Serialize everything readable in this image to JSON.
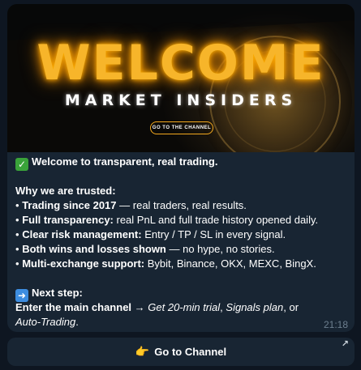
{
  "banner": {
    "title": "WELCOME",
    "subtitle": "MARKET INSIDERS",
    "button_label": "GO TO THE CHANNEL"
  },
  "message": {
    "headline": "Welcome to transparent, real trading.",
    "why_heading": "Why we are trusted:",
    "bullets": [
      {
        "bold": "Trading since 2017",
        "rest": " — real traders, real results."
      },
      {
        "bold": "Full transparency:",
        "rest": " real PnL and full trade history opened daily."
      },
      {
        "bold": "Clear risk management:",
        "rest": " Entry / TP / SL in every signal."
      },
      {
        "bold": "Both wins and losses shown",
        "rest": " — no hype, no stories."
      },
      {
        "bold": "Multi-exchange support:",
        "rest": " Bybit, Binance, OKX, MEXC, BingX."
      }
    ],
    "bullet_char": "•",
    "next_step_label": "Next step:",
    "next_step_line1_bold": "Enter the main channel →",
    "next_step_line1_italic_a": "Get 20-min trial",
    "next_step_sep": ",",
    "next_step_line1_italic_b": "Signals plan",
    "next_step_or": ", or",
    "next_step_line2_italic": "Auto-Trading",
    "next_step_line2_end": ".",
    "time": "21:18"
  },
  "cta": {
    "label": "Go to Channel",
    "hand_icon": "👉",
    "external_icon": "↗"
  },
  "colors": {
    "background": "#0e1621",
    "bubble": "#182533",
    "accent_gold": "#f7b52a",
    "timestamp": "#6d7f8f"
  }
}
